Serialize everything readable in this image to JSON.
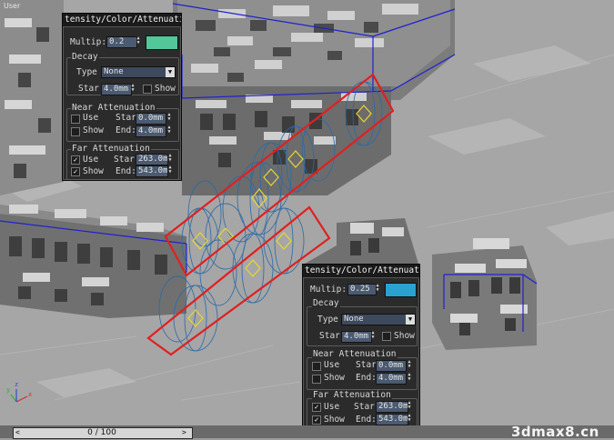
{
  "viewport": {
    "label": "User"
  },
  "panel_top": {
    "title": "tensity/Color/Attenuati",
    "multiplier_label": "Multip:",
    "multiplier_value": "0.2",
    "color": "#53c79a",
    "decay_label": "Decay",
    "type_label": "Type",
    "type_value": "None",
    "start_label": "Star",
    "start_value": "4.0mm",
    "show_label": "Show",
    "near_label": "Near Attenuation",
    "near_use_label": "Use",
    "near_show_label": "Show",
    "near_start_label": "Star",
    "near_start_value": "0.0mm",
    "near_end_label": "End:",
    "near_end_value": "4.0mm",
    "far_label": "Far Attenuation",
    "far_use_label": "Use",
    "far_show_label": "Show",
    "far_start_label": "Star",
    "far_start_value": "263.0m",
    "far_end_label": "End:",
    "far_end_value": "543.0m"
  },
  "panel_bottom": {
    "title": "tensity/Color/Attenuati",
    "multiplier_label": "Multip:",
    "multiplier_value": "0.25",
    "color": "#2aa2d0",
    "decay_label": "Decay",
    "type_label": "Type",
    "type_value": "None",
    "start_label": "Star",
    "start_value": "4.0mm",
    "show_label": "Show",
    "near_label": "Near Attenuation",
    "near_use_label": "Use",
    "near_show_label": "Show",
    "near_start_label": "Star",
    "near_start_value": "0.0mm",
    "near_end_label": "End:",
    "near_end_value": "4.0mm",
    "far_label": "Far Attenuation",
    "far_use_label": "Use",
    "far_show_label": "Show",
    "far_start_label": "Star",
    "far_start_value": "263.0m",
    "far_end_label": "End:",
    "far_end_value": "543.0m"
  },
  "timeline": {
    "readout": "0 / 100",
    "prev": "<",
    "next": ">"
  },
  "axes": {
    "x": "x",
    "y": "y",
    "z": "z"
  },
  "watermark": "3dmax8.cn",
  "colors": {
    "highlight": "#e02020",
    "bounding_box": "#2020d0",
    "attenuation": "#2a6aa8",
    "light_icon": "#e8d830"
  }
}
